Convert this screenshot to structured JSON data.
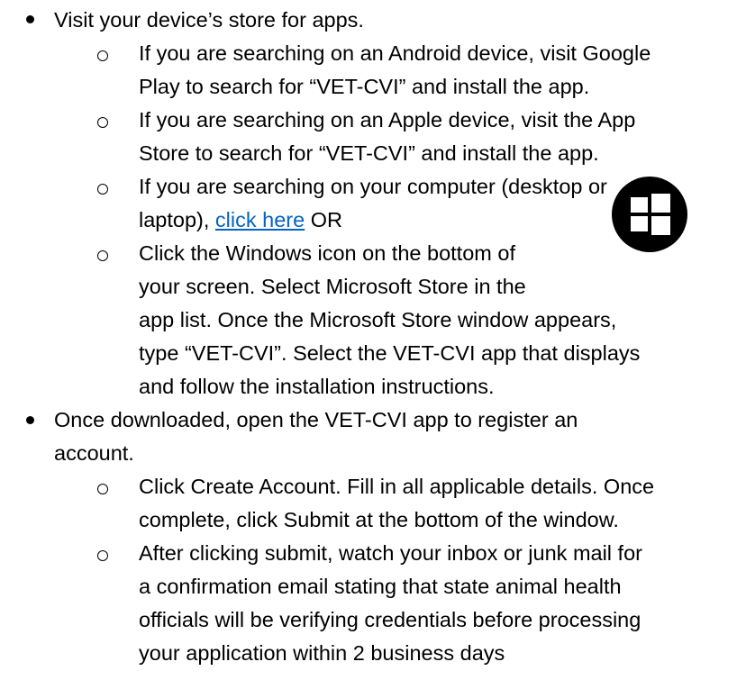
{
  "items": [
    {
      "text_lines": [
        "Visit your device’s store for apps."
      ],
      "subitems": [
        {
          "lines": [
            "If you are searching on an Android device, visit Google",
            "Play to search for “VET-CVI” and install the app."
          ]
        },
        {
          "lines": [
            "If you are searching on an Apple device, visit the App",
            "Store to search for “VET-CVI” and install the app."
          ]
        },
        {
          "lines": [
            "If you are searching on your computer (desktop or"
          ],
          "link_prefix": "laptop), ",
          "link_text": "click here",
          "link_suffix": " OR"
        },
        {
          "lines": [
            "Click the Windows icon on the bottom of",
            "your screen. Select Microsoft Store in the",
            "app list. Once the Microsoft Store window appears,",
            "type “VET-CVI”. Select the VET-CVI app that displays",
            "and follow the installation instructions."
          ]
        }
      ]
    },
    {
      "text_lines": [
        "Once downloaded, open the VET-CVI app to register an",
        "account."
      ],
      "subitems": [
        {
          "lines": [
            "Click Create Account. Fill in all applicable details. Once",
            "complete, click Submit at the bottom of the window."
          ]
        },
        {
          "lines": [
            "After clicking submit, watch your inbox or junk mail for",
            "a confirmation email stating that state animal health",
            "officials will be verifying credentials before processing",
            "your application within 2 business days"
          ]
        }
      ]
    }
  ],
  "icons": {
    "windows": "windows-logo-icon"
  },
  "colors": {
    "link": "#0563c1",
    "text": "#000000"
  }
}
